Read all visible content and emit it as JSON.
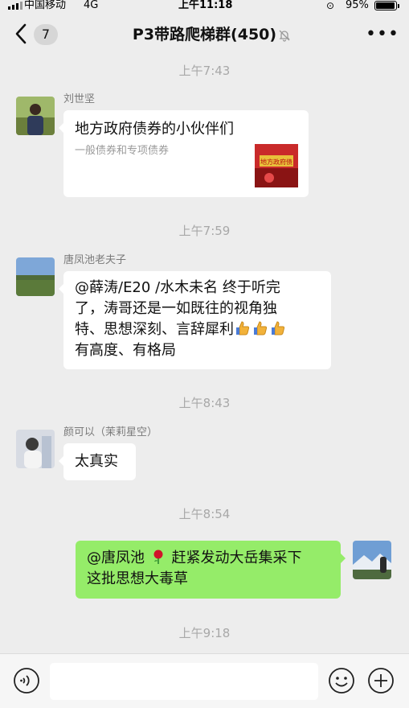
{
  "status": {
    "carrier": "中国移动",
    "network": "4G",
    "time": "上午11:18",
    "battery": "95%",
    "battery_level": 0.95
  },
  "nav": {
    "unread_count": "7",
    "title": "P3带路爬梯群(450)"
  },
  "timestamps": [
    "上午7:43",
    "上午7:59",
    "上午8:43",
    "上午8:54",
    "上午9:18"
  ],
  "messages": [
    {
      "sender": "刘世坚",
      "type": "link-card",
      "title": "地方政府债券的小伙伴们",
      "description": "一般债券和专项债券",
      "thumb_text": "地方政府债"
    },
    {
      "sender": "唐凤池老夫子",
      "type": "text",
      "lines": [
        "@薛涛/E20 /水木未名 终于听完",
        "了，涛哥还是一如既往的视角独",
        "特、思想深刻、言辞犀利",
        "有高度、有格局"
      ]
    },
    {
      "sender": "颜可以（茉莉星空）",
      "type": "text",
      "text": "太真实"
    },
    {
      "sender": "me",
      "type": "text",
      "line1_prefix": "@唐凤池 ",
      "line1_suffix": " 赶紧发动大岳集采下",
      "line2": "这批思想大毒草"
    }
  ],
  "icons": {
    "back": "chevron-left-icon",
    "mute": "bell-off-icon",
    "more": "more-icon",
    "voice": "voice-icon",
    "emoji": "emoji-icon",
    "plus": "plus-icon",
    "thumbs_up": "thumbs-up-icon",
    "rose": "rose-icon"
  },
  "colors": {
    "background": "#ededed",
    "my_bubble": "#95ec69",
    "other_bubble": "#ffffff"
  }
}
